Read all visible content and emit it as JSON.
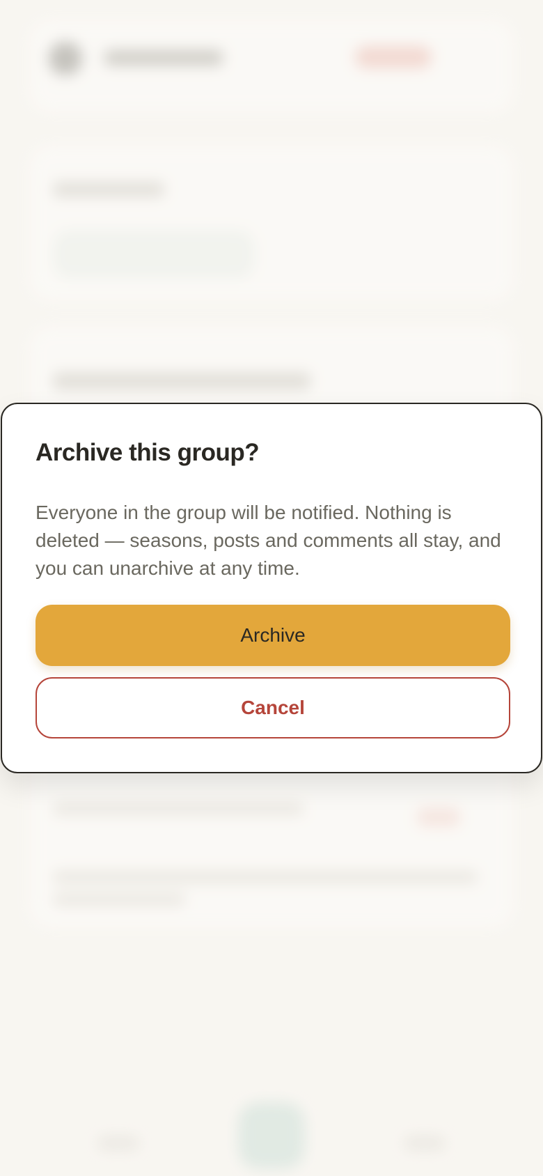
{
  "dialog": {
    "title": "Archive this group?",
    "body": "Everyone in the group will be notified. Nothing is deleted — seasons, posts and comments all stay, and you can unarchive at any time.",
    "confirm_label": "Archive",
    "cancel_label": "Cancel"
  },
  "colors": {
    "confirm_button": "#e3a73b",
    "cancel_accent": "#b5453a",
    "text_primary": "#2a2823",
    "text_secondary": "#6a685f",
    "background": "#f8f6f2"
  }
}
